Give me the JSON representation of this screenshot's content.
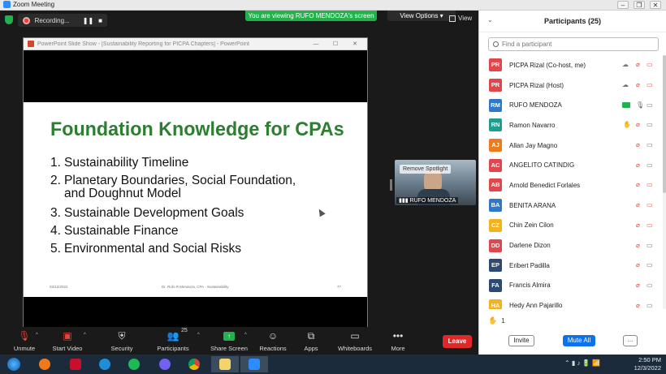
{
  "window": {
    "title": "Zoom Meeting"
  },
  "meeting": {
    "recording_label": "Recording...",
    "viewing_banner": "You are viewing RUFO MENDOZA's screen",
    "view_options_label": "View Options",
    "view_label": "View"
  },
  "ppt": {
    "title": "PowerPoint Slide Show - [Sustainability Reporting for PICPA Chapters] - PowerPoint",
    "slide": {
      "title": "Foundation Knowledge for CPAs",
      "items": [
        {
          "num": "1.",
          "text": "Sustainability Timeline"
        },
        {
          "num": "2.",
          "text": "Planetary Boundaries, Social Foundation,",
          "cont": "and Doughnut Model"
        },
        {
          "num": "3.",
          "text": "Sustainable Development Goals"
        },
        {
          "num": "4.",
          "text": "Sustainable Finance"
        },
        {
          "num": "5.",
          "text": "Environmental and Social Risks"
        }
      ],
      "footer_date": "03/12/2022",
      "footer_center": "Dr. Rufo R Mendoza, CPA - Sustainability",
      "footer_page": "77"
    }
  },
  "video": {
    "remove_spotlight": "Remove Spotlight",
    "name": "RUFO MENDOZA"
  },
  "toolbar": {
    "unmute": "Unmute",
    "start_video": "Start Video",
    "security": "Security",
    "participants": "Participants",
    "participants_count": "25",
    "share_screen": "Share Screen",
    "reactions": "Reactions",
    "apps": "Apps",
    "whiteboards": "Whiteboards",
    "more": "More",
    "leave": "Leave"
  },
  "panel": {
    "title": "Participants (25)",
    "search_placeholder": "Find a participant",
    "raised_hands_count": "1",
    "invite": "Invite",
    "mute_all": "Mute All",
    "more": "..."
  },
  "participants": [
    {
      "initials": "PR",
      "name": "PICPA Rizal (Co-host, me)",
      "color": "#e0464c",
      "mic": "muted",
      "video": "off",
      "cloud": true,
      "hand": false,
      "screen": false
    },
    {
      "initials": "PR",
      "name": "PICPA Rizal (Host)",
      "color": "#e0464c",
      "mic": "muted",
      "video": "off",
      "cloud": true,
      "hand": false,
      "screen": false
    },
    {
      "initials": "RM",
      "name": "RUFO MENDOZA",
      "color": "#2f77c9",
      "mic": "on",
      "video": "on",
      "cloud": false,
      "hand": false,
      "screen": true
    },
    {
      "initials": "RN",
      "name": "Ramon Navarro",
      "color": "#1f9e8f",
      "mic": "muted",
      "video": "on",
      "cloud": false,
      "hand": true,
      "screen": false
    },
    {
      "initials": "AJ",
      "name": "Allan Jay Magno",
      "color": "#f07a19",
      "mic": "muted",
      "video": "on",
      "cloud": false,
      "hand": false,
      "screen": false
    },
    {
      "initials": "AC",
      "name": "ANGELITO CATINDIG",
      "color": "#e0464c",
      "mic": "muted",
      "video": "on",
      "cloud": false,
      "hand": false,
      "screen": false
    },
    {
      "initials": "AB",
      "name": "Arnold Benedict Forlales",
      "color": "#e0464c",
      "mic": "muted",
      "video": "off",
      "cloud": false,
      "hand": false,
      "screen": false
    },
    {
      "initials": "BA",
      "name": "BENITA ARANA",
      "color": "#2f77c9",
      "mic": "muted",
      "video": "off",
      "cloud": false,
      "hand": false,
      "screen": false
    },
    {
      "initials": "CZ",
      "name": "Chin Zein Cilon",
      "color": "#f2b320",
      "mic": "muted",
      "video": "off",
      "cloud": false,
      "hand": false,
      "screen": false
    },
    {
      "initials": "DD",
      "name": "Darlene Dizon",
      "color": "#e0464c",
      "mic": "muted",
      "video": "on",
      "cloud": false,
      "hand": false,
      "screen": false
    },
    {
      "initials": "EP",
      "name": "Eribert Padilla",
      "color": "#2c4a72",
      "mic": "muted",
      "video": "on",
      "cloud": false,
      "hand": false,
      "screen": false
    },
    {
      "initials": "FA",
      "name": "Francis Almira",
      "color": "#2c4a72",
      "mic": "muted",
      "video": "on",
      "cloud": false,
      "hand": false,
      "screen": false
    },
    {
      "initials": "HA",
      "name": "Hedy Ann Pajarillo",
      "color": "#f2b320",
      "mic": "muted",
      "video": "on",
      "cloud": false,
      "hand": false,
      "screen": false
    }
  ],
  "taskbar": {
    "time": "2:50 PM",
    "date": "12/3/2022",
    "apps": [
      "start-orb",
      "media-player",
      "adobe-reader",
      "internet-explorer",
      "spotify",
      "viber",
      "chrome",
      "file-explorer",
      "zoom"
    ]
  },
  "colors": {
    "accent_green": "#23b14d",
    "zoom_blue": "#0e72ed",
    "leave_red": "#e02828",
    "slide_title_green": "#2e7d32"
  }
}
